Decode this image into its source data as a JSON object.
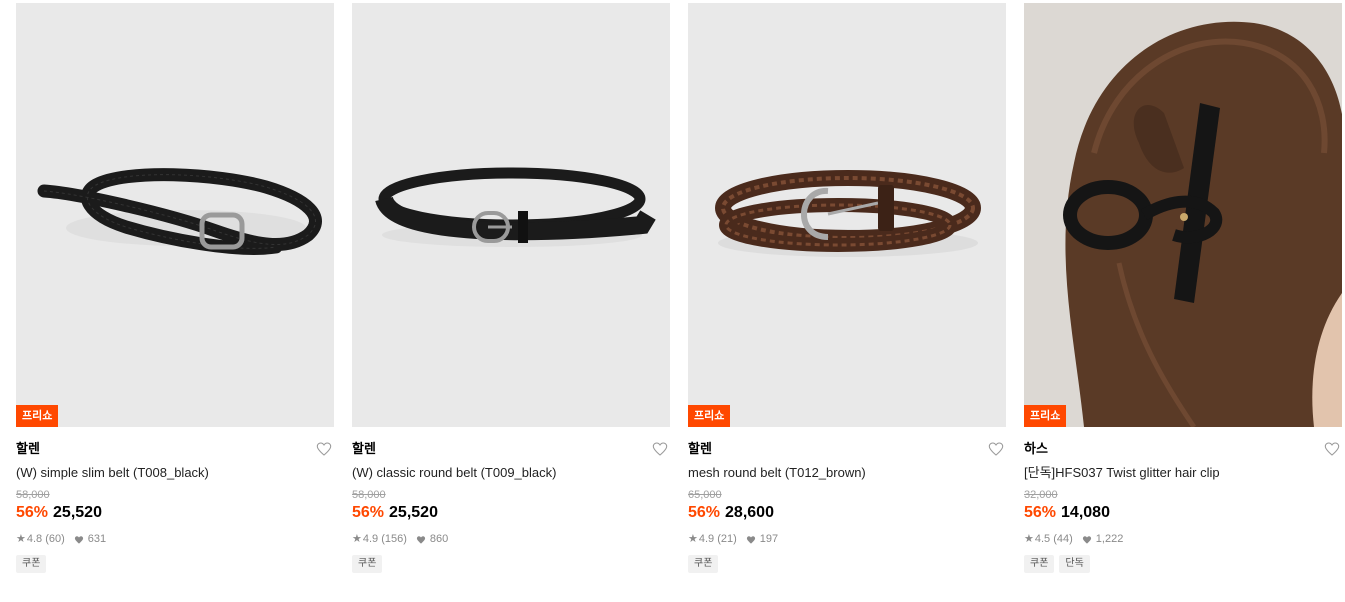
{
  "products": [
    {
      "badge": "프리쇼",
      "brand": "할렌",
      "name": "(W) simple slim belt (T008_black)",
      "original_price": "58,000",
      "discount": "56%",
      "price": "25,520",
      "rating": "4.8",
      "reviews": "(60)",
      "likes": "631",
      "tags": [
        "쿠폰"
      ],
      "image": "black-slim-belt-coiled"
    },
    {
      "badge": "",
      "brand": "할렌",
      "name": "(W) classic round belt (T009_black)",
      "original_price": "58,000",
      "discount": "56%",
      "price": "25,520",
      "rating": "4.9",
      "reviews": "(156)",
      "likes": "860",
      "tags": [
        "쿠폰"
      ],
      "image": "black-round-belt"
    },
    {
      "badge": "프리쇼",
      "brand": "할렌",
      "name": "mesh round belt (T012_brown)",
      "original_price": "65,000",
      "discount": "56%",
      "price": "28,600",
      "rating": "4.9",
      "reviews": "(21)",
      "likes": "197",
      "tags": [
        "쿠폰"
      ],
      "image": "brown-braided-belt"
    },
    {
      "badge": "프리쇼",
      "brand": "하스",
      "name": "[단독]HFS037 Twist glitter hair clip",
      "original_price": "32,000",
      "discount": "56%",
      "price": "14,080",
      "rating": "4.5",
      "reviews": "(44)",
      "likes": "1,222",
      "tags": [
        "쿠폰",
        "단독"
      ],
      "image": "black-hair-claw-clip-in-hair"
    }
  ],
  "colors": {
    "accent": "#ff4800",
    "thumb_bg": "#e9e9e9",
    "muted": "#8a8a8a"
  }
}
